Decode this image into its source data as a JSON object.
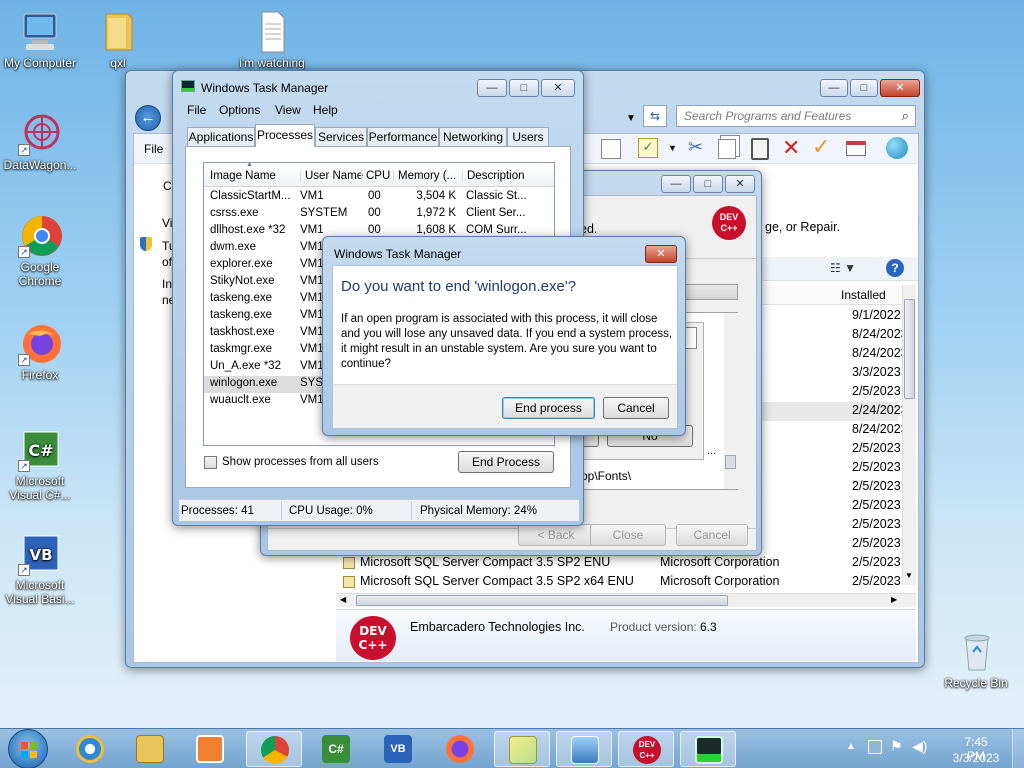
{
  "desktop": {
    "icons": [
      {
        "label": "My Computer"
      },
      {
        "label": "qxl"
      },
      {
        "label": "i'm watching"
      },
      {
        "label": "DataWagon..."
      },
      {
        "label": "Google Chrome"
      },
      {
        "label": "Firefox"
      },
      {
        "label": "Microsoft Visual C#..."
      },
      {
        "label": "Microsoft Visual Basi..."
      },
      {
        "label": "Recycle Bin"
      }
    ]
  },
  "programs": {
    "search_placeholder": "Search Programs and Features",
    "file_menu": "File",
    "trunc_c": "C",
    "trunc_vi": "Vi",
    "trunc_tu": "Tu",
    "trunc_of": "of",
    "trunc_in": "In",
    "trunc_ne": "ne",
    "ed_text": "ed.",
    "repair_text": "ge, or Repair.",
    "installed_header": "Installed",
    "rows": [
      {
        "name": "",
        "publisher": "",
        "date": "9/1/2022"
      },
      {
        "name": "",
        "publisher": "",
        "date": "8/24/2023"
      },
      {
        "name": "",
        "publisher": "",
        "date": "8/24/2023"
      },
      {
        "name": "",
        "publisher": "",
        "date": "3/3/2023"
      },
      {
        "name": "",
        "publisher": "ion",
        "date": "2/5/2023"
      },
      {
        "name": "",
        "publisher": "nologies Inc.",
        "date": "2/24/2023"
      },
      {
        "name": "",
        "publisher": "",
        "date": "8/24/2023"
      },
      {
        "name": "",
        "publisher": "ion",
        "date": "2/5/2023"
      },
      {
        "name": "",
        "publisher": "ion",
        "date": "2/5/2023"
      },
      {
        "name": "",
        "publisher": "ion",
        "date": "2/5/2023"
      },
      {
        "name": "",
        "publisher": "ion",
        "date": "2/5/2023"
      },
      {
        "name": "",
        "publisher": "ion",
        "date": "2/5/2023"
      },
      {
        "name": "",
        "publisher": "ion",
        "date": "2/5/2023"
      },
      {
        "name": "Microsoft SQL Server Compact 3.5 SP2 ENU",
        "publisher": "Microsoft Corporation",
        "date": "2/5/2023"
      },
      {
        "name": "Microsoft SQL Server Compact 3.5 SP2 x64 ENU",
        "publisher": "Microsoft Corporation",
        "date": "2/5/2023"
      }
    ],
    "footer_company": "Embarcadero Technologies Inc.",
    "footer_version_label": "Product version:",
    "footer_version": "6.3",
    "devcpp_logo": "DEV C++"
  },
  "setup": {
    "back": "< Back",
    "close": "Close",
    "cancel": "Cancel",
    "no": "No",
    "fonts_path": "op\\Fonts\\"
  },
  "taskmgr": {
    "title": "Windows Task Manager",
    "menu": [
      "File",
      "Options",
      "View",
      "Help"
    ],
    "tabs": [
      "Applications",
      "Processes",
      "Services",
      "Performance",
      "Networking",
      "Users"
    ],
    "columns": [
      "Image Name",
      "User Name",
      "CPU",
      "Memory (...",
      "Description"
    ],
    "processes": [
      {
        "name": "ClassicStartM...",
        "user": "VM1",
        "cpu": "00",
        "mem": "3,504 K",
        "desc": "Classic St..."
      },
      {
        "name": "csrss.exe",
        "user": "SYSTEM",
        "cpu": "00",
        "mem": "1,972 K",
        "desc": "Client Ser..."
      },
      {
        "name": "dllhost.exe *32",
        "user": "VM1",
        "cpu": "00",
        "mem": "1,608 K",
        "desc": "COM Surr..."
      },
      {
        "name": "dwm.exe",
        "user": "VM1",
        "cpu": "",
        "mem": "",
        "desc": ""
      },
      {
        "name": "explorer.exe",
        "user": "VM1",
        "cpu": "",
        "mem": "",
        "desc": ""
      },
      {
        "name": "StikyNot.exe",
        "user": "VM1",
        "cpu": "",
        "mem": "",
        "desc": ""
      },
      {
        "name": "taskeng.exe",
        "user": "VM1",
        "cpu": "",
        "mem": "",
        "desc": ""
      },
      {
        "name": "taskeng.exe",
        "user": "VM1",
        "cpu": "",
        "mem": "",
        "desc": ""
      },
      {
        "name": "taskhost.exe",
        "user": "VM1",
        "cpu": "",
        "mem": "",
        "desc": ""
      },
      {
        "name": "taskmgr.exe",
        "user": "VM1",
        "cpu": "",
        "mem": "",
        "desc": ""
      },
      {
        "name": "Un_A.exe *32",
        "user": "VM1",
        "cpu": "",
        "mem": "",
        "desc": ""
      },
      {
        "name": "winlogon.exe",
        "user": "SYST",
        "cpu": "",
        "mem": "",
        "desc": ""
      },
      {
        "name": "wuauclt.exe",
        "user": "VM1",
        "cpu": "",
        "mem": "",
        "desc": ""
      }
    ],
    "show_all_label": "Show processes from all users",
    "end_process_btn": "End Process",
    "status_processes": "Processes: 41",
    "status_cpu": "CPU Usage: 0%",
    "status_memory": "Physical Memory: 24%"
  },
  "confirm": {
    "title": "Windows Task Manager",
    "question": "Do you want to end 'winlogon.exe'?",
    "body": "If an open program is associated with this process, it will close and you will lose any unsaved data. If you end a system process, it might result in an unstable system. Are you sure you want to continue?",
    "end_btn": "End process",
    "cancel_btn": "Cancel"
  },
  "tray": {
    "time": "7:45 PM",
    "date": "3/3/2023"
  },
  "colors": {
    "accent": "#3c7fb1",
    "selection": "#cce8ff",
    "devcpp": "#c8102e"
  }
}
